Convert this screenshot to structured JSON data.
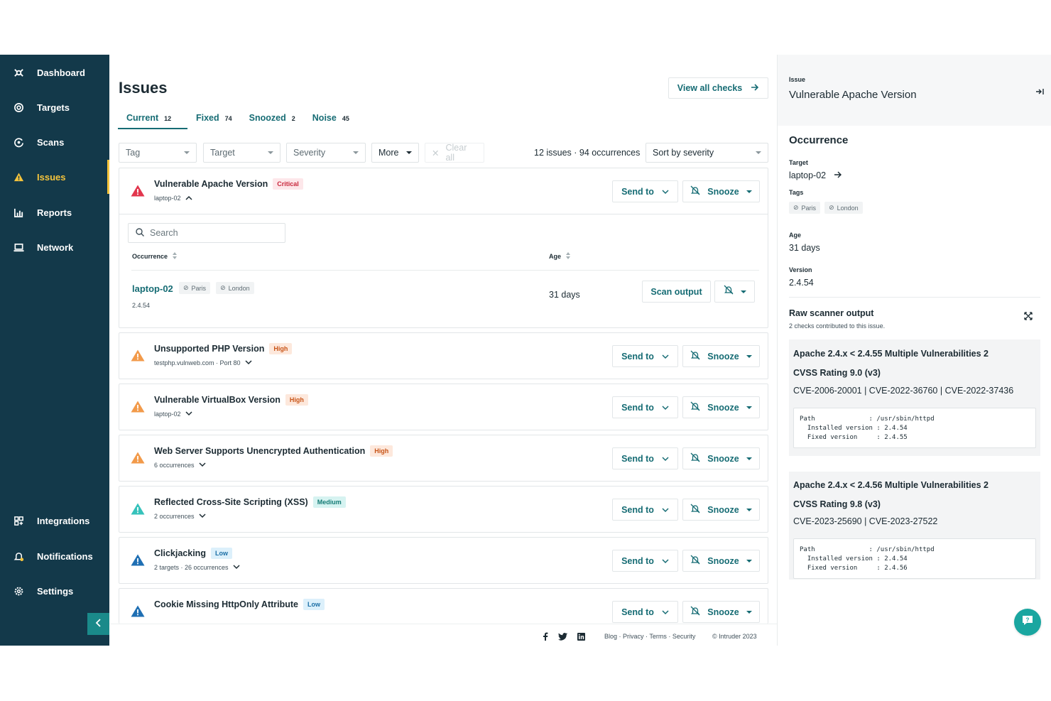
{
  "colors": {
    "sidebar_bg": "#13394a",
    "accent": "#166c74",
    "active_nav": "#f5c43c"
  },
  "sidebar": {
    "items": [
      {
        "label": "Dashboard",
        "icon": "dashboard-icon"
      },
      {
        "label": "Targets",
        "icon": "target-icon"
      },
      {
        "label": "Scans",
        "icon": "scan-icon"
      },
      {
        "label": "Issues",
        "icon": "warning-icon",
        "active": true
      },
      {
        "label": "Reports",
        "icon": "chart-icon"
      },
      {
        "label": "Network",
        "icon": "laptop-icon"
      }
    ],
    "bottom_items": [
      {
        "label": "Integrations",
        "icon": "grid-icon"
      },
      {
        "label": "Notifications",
        "icon": "bell-icon"
      },
      {
        "label": "Settings",
        "icon": "gear-icon"
      }
    ]
  },
  "header": {
    "title": "Issues",
    "view_all": "View all checks"
  },
  "tabs": [
    {
      "label": "Current",
      "count": "12"
    },
    {
      "label": "Fixed",
      "count": "74"
    },
    {
      "label": "Snoozed",
      "count": "2"
    },
    {
      "label": "Noise",
      "count": "45"
    }
  ],
  "filters": {
    "tag": "Tag",
    "target": "Target",
    "severity": "Severity",
    "more": "More",
    "clear": "Clear all"
  },
  "counts": "12 issues · 94 occurrences",
  "sort": "Sort by severity",
  "actions": {
    "send_to": "Send to",
    "snooze": "Snooze",
    "scan_output": "Scan output"
  },
  "issues": [
    {
      "title": "Vulnerable Apache Version",
      "severity": "Critical",
      "sub": "laptop-02"
    },
    {
      "title": "Unsupported PHP Version",
      "severity": "High",
      "sub": "testphp.vulnweb.com · Port 80"
    },
    {
      "title": "Vulnerable VirtualBox Version",
      "severity": "High",
      "sub": "laptop-02"
    },
    {
      "title": "Web Server Supports Unencrypted Authentication",
      "severity": "High",
      "sub": "6 occurrences"
    },
    {
      "title": "Reflected Cross-Site Scripting (XSS)",
      "severity": "Medium",
      "sub": "2 occurrences"
    },
    {
      "title": "Clickjacking",
      "severity": "Low",
      "sub": "2 targets · 26 occurrences"
    },
    {
      "title": "Cookie Missing HttpOnly Attribute",
      "severity": "Low",
      "sub": ""
    }
  ],
  "occurrence_table": {
    "search_placeholder": "Search",
    "col_occurrence": "Occurrence",
    "col_age": "Age",
    "row": {
      "target": "laptop-02",
      "tags": [
        "Paris",
        "London"
      ],
      "version": "2.4.54",
      "age": "31 days"
    }
  },
  "footer": {
    "links": "Blog · Privacy · Terms · Security",
    "copyright": "Intruder 2023"
  },
  "panel": {
    "issue_label": "Issue",
    "issue_title": "Vulnerable Apache Version",
    "occurrence_title": "Occurrence",
    "target_label": "Target",
    "target_value": "laptop-02",
    "tags_label": "Tags",
    "tags": [
      "Paris",
      "London"
    ],
    "age_label": "Age",
    "age_value": "31 days",
    "version_label": "Version",
    "version_value": "2.4.54",
    "raw_title": "Raw scanner output",
    "raw_sub": "2 checks contributed to this issue.",
    "checks": [
      {
        "title": "Apache 2.4.x < 2.4.55 Multiple Vulnerabilities 2",
        "cvss": "CVSS Rating 9.0 (v3)",
        "cves": "CVE-2006-20001 | CVE-2022-36760 | CVE-2022-37436",
        "code": "Path              : /usr/sbin/httpd\n  Installed version : 2.4.54\n  Fixed version     : 2.4.55"
      },
      {
        "title": "Apache 2.4.x < 2.4.56 Multiple Vulnerabilities 2",
        "cvss": "CVSS Rating 9.8 (v3)",
        "cves": "CVE-2023-25690 | CVE-2023-27522",
        "code": "Path              : /usr/sbin/httpd\n  Installed version : 2.4.54\n  Fixed version     : 2.4.56"
      }
    ]
  }
}
